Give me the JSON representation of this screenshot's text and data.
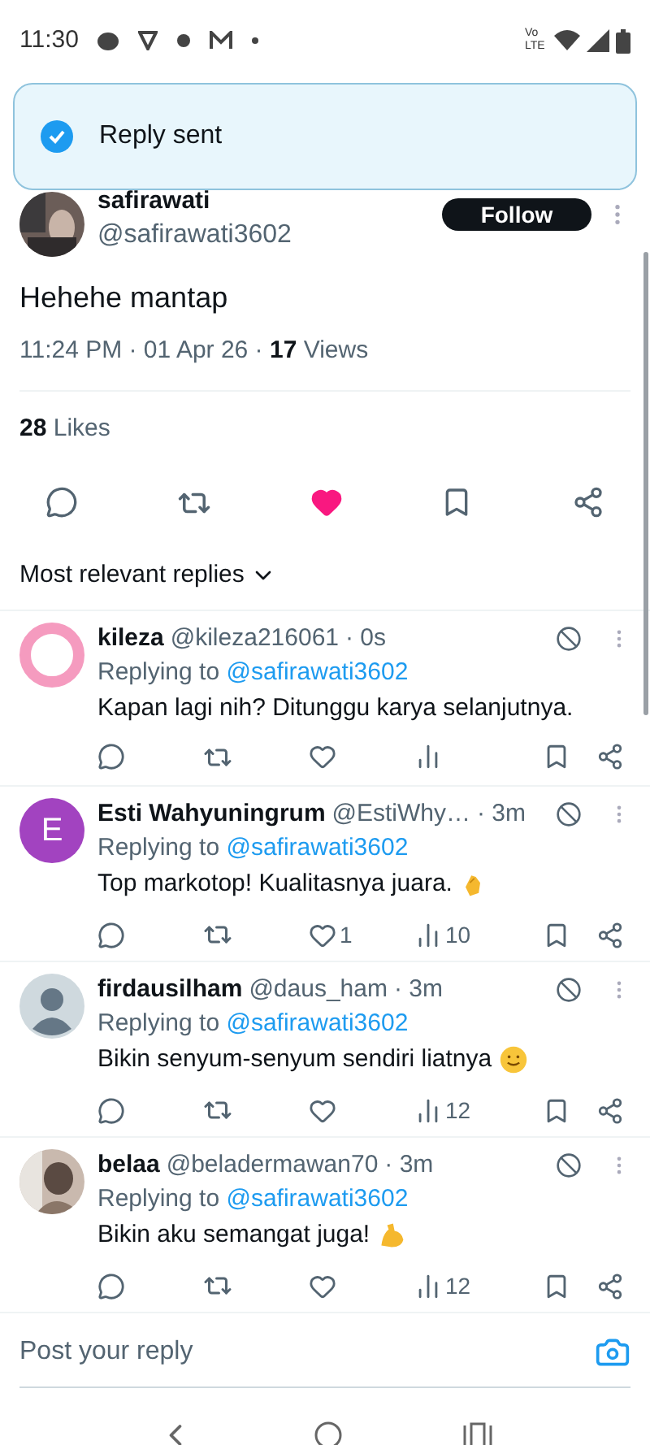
{
  "status_bar": {
    "time": "11:30",
    "network": "Vo LTE"
  },
  "toast": {
    "text": "Reply sent"
  },
  "post": {
    "author": "safirawati",
    "handle": "@safirawati3602",
    "follow": "Follow",
    "text": "Hehehe mantap",
    "time": "11:24 PM · 01 Apr 26 · ",
    "views_count": "17",
    "views_label": " Views",
    "likes_count": "28",
    "likes_label": " Likes",
    "liked": true,
    "bookmarked": false
  },
  "sort": {
    "label": "Most relevant replies"
  },
  "replies": [
    {
      "name": "kileza",
      "handle": "@kileza216061",
      "time": "· 0s",
      "replying_label": "Replying to ",
      "replying_to": "@safirawati3602",
      "text": "Kapan lagi nih? Ditunggu karya selanjutnya.",
      "avatar": {
        "kind": "ring",
        "color": "#f59bbf"
      },
      "liked": false
    },
    {
      "name": "Esti Wahyuningrum",
      "handle": "@EstiWhy…",
      "time": "· 3m",
      "replying_label": "Replying to ",
      "replying_to": "@safirawati3602",
      "text": "Top markotop! Kualitasnya juara.",
      "avatar": {
        "kind": "letter",
        "letter": "E",
        "color": "#a243c0"
      },
      "emoji": {
        "kind": "clap"
      },
      "liked": false,
      "likes": "1",
      "views": "10"
    },
    {
      "name": "firdausilham",
      "handle": "@daus_ham",
      "time": "· 3m",
      "replying_label": "Replying to ",
      "replying_to": "@safirawati3602",
      "text": "Bikin senyum-senyum sendiri liatnya",
      "avatar": {
        "kind": "silhouette",
        "color": "#cfd9de"
      },
      "emoji": {
        "kind": "smile"
      },
      "liked": false,
      "views": "12"
    },
    {
      "name": "belaa",
      "handle": "@beladermawan70",
      "time": "· 3m",
      "replying_label": "Replying to ",
      "replying_to": "@safirawati3602",
      "text": "Bikin aku semangat juga!",
      "emoji": {
        "kind": "muscle"
      },
      "liked": false,
      "views": "12"
    }
  ],
  "reply_field": {
    "placeholder": "Post your reply"
  }
}
